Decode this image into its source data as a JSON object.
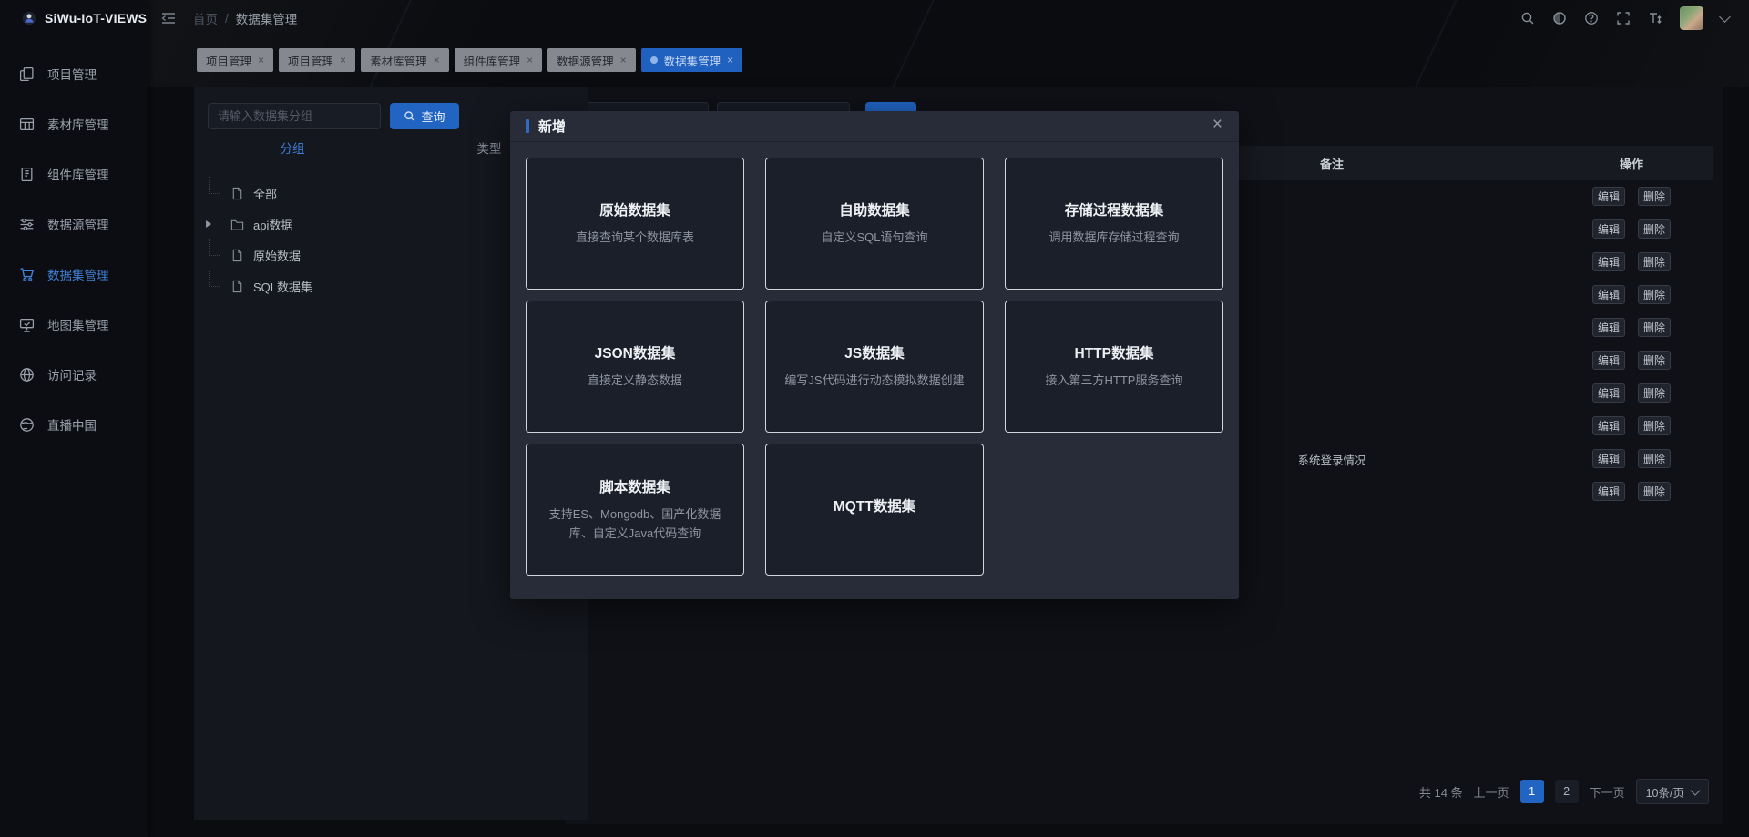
{
  "app": {
    "title": "SiWu-IoT-VIEWS"
  },
  "icons": {
    "close": "×"
  },
  "colors": {
    "accent_blue": "#2164c2",
    "active_tab_bg": "#2060bf",
    "active_text": "#4181d6"
  },
  "topbar": {
    "breadcrumb": {
      "home": "首页",
      "separator": "/",
      "current": "数据集管理"
    }
  },
  "sidebar": {
    "items": [
      {
        "label": "项目管理"
      },
      {
        "label": "素材库管理"
      },
      {
        "label": "组件库管理"
      },
      {
        "label": "数据源管理"
      },
      {
        "label": "数据集管理",
        "active": true
      },
      {
        "label": "地图集管理"
      },
      {
        "label": "访问记录"
      },
      {
        "label": "直播中国"
      }
    ]
  },
  "tabs": [
    {
      "label": "项目管理"
    },
    {
      "label": "项目管理"
    },
    {
      "label": "素材库管理"
    },
    {
      "label": "组件库管理"
    },
    {
      "label": "数据源管理"
    },
    {
      "label": "数据集管理",
      "active": true
    }
  ],
  "left_panel": {
    "search_placeholder": "请输入数据集分组",
    "search_button": "查询",
    "tabs": [
      {
        "label": "分组",
        "active": true
      },
      {
        "label": "类型"
      }
    ],
    "tree": [
      {
        "label": "全部"
      },
      {
        "label": "api数据"
      },
      {
        "label": "原始数据"
      },
      {
        "label": "SQL数据集"
      }
    ]
  },
  "table": {
    "headers": {
      "remark": "备注",
      "actions": "操作"
    },
    "edit_label": "编辑",
    "delete_label": "删除",
    "rows": [
      {
        "remark": ""
      },
      {
        "remark": ""
      },
      {
        "remark": ""
      },
      {
        "remark": ""
      },
      {
        "remark": ""
      },
      {
        "remark": ""
      },
      {
        "remark": ""
      },
      {
        "remark": ""
      },
      {
        "remark": "系统登录情况"
      },
      {
        "remark": ""
      }
    ]
  },
  "pagination": {
    "total": "共 14 条",
    "prev": "上一页",
    "page1": "1",
    "page2": "2",
    "next": "下一页",
    "page_size": "10条/页"
  },
  "modal": {
    "title": "新增",
    "cards": [
      {
        "title": "原始数据集",
        "desc": "直接查询某个数据库表"
      },
      {
        "title": "自助数据集",
        "desc": "自定义SQL语句查询"
      },
      {
        "title": "存储过程数据集",
        "desc": "调用数据库存储过程查询"
      },
      {
        "title": "JSON数据集",
        "desc": "直接定义静态数据"
      },
      {
        "title": "JS数据集",
        "desc": "编写JS代码进行动态模拟数据创建"
      },
      {
        "title": "HTTP数据集",
        "desc": "接入第三方HTTP服务查询"
      },
      {
        "title": "脚本数据集",
        "desc": "支持ES、Mongodb、国产化数据库、自定义Java代码查询"
      },
      {
        "title": "MQTT数据集",
        "desc": ""
      }
    ]
  }
}
